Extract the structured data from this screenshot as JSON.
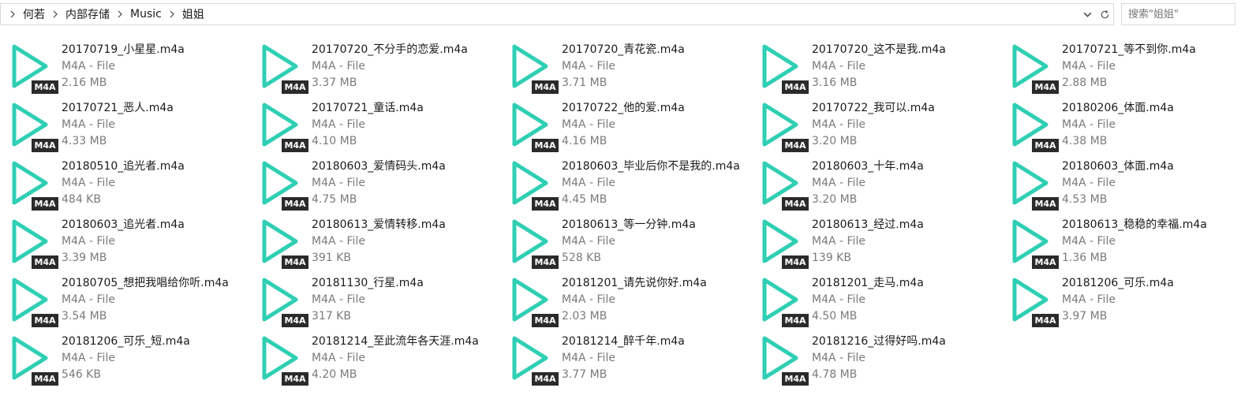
{
  "breadcrumb": {
    "items": [
      "何若",
      "内部存储",
      "Music",
      "姐姐"
    ]
  },
  "search": {
    "placeholder": "搜索\"姐姐\""
  },
  "icons": {
    "play": "play-icon",
    "chevron": "chevron-right-icon",
    "dropdown": "chevron-down-icon",
    "refresh": "refresh-icon"
  },
  "colors": {
    "accent": "#2fcfb4",
    "badge_bg": "#2b2b2b"
  },
  "files": [
    {
      "name": "20170719_小星星.m4a",
      "type": "M4A - File",
      "size": "2.16 MB",
      "badge": "M4A"
    },
    {
      "name": "20170720_不分手的恋爱.m4a",
      "type": "M4A - File",
      "size": "3.37 MB",
      "badge": "M4A"
    },
    {
      "name": "20170720_青花瓷.m4a",
      "type": "M4A - File",
      "size": "3.71 MB",
      "badge": "M4A"
    },
    {
      "name": "20170720_这不是我.m4a",
      "type": "M4A - File",
      "size": "3.16 MB",
      "badge": "M4A"
    },
    {
      "name": "20170721_等不到你.m4a",
      "type": "M4A - File",
      "size": "2.88 MB",
      "badge": "M4A"
    },
    {
      "name": "20170721_恶人.m4a",
      "type": "M4A - File",
      "size": "4.33 MB",
      "badge": "M4A"
    },
    {
      "name": "20170721_童话.m4a",
      "type": "M4A - File",
      "size": "4.10 MB",
      "badge": "M4A"
    },
    {
      "name": "20170722_他的爱.m4a",
      "type": "M4A - File",
      "size": "4.16 MB",
      "badge": "M4A"
    },
    {
      "name": "20170722_我可以.m4a",
      "type": "M4A - File",
      "size": "3.20 MB",
      "badge": "M4A"
    },
    {
      "name": "20180206_体面.m4a",
      "type": "M4A - File",
      "size": "4.38 MB",
      "badge": "M4A"
    },
    {
      "name": "20180510_追光者.m4a",
      "type": "M4A - File",
      "size": "484 KB",
      "badge": "M4A"
    },
    {
      "name": "20180603_爱情码头.m4a",
      "type": "M4A - File",
      "size": "4.75 MB",
      "badge": "M4A"
    },
    {
      "name": "20180603_毕业后你不是我的.m4a",
      "type": "M4A - File",
      "size": "4.45 MB",
      "badge": "M4A"
    },
    {
      "name": "20180603_十年.m4a",
      "type": "M4A - File",
      "size": "3.20 MB",
      "badge": "M4A"
    },
    {
      "name": "20180603_体面.m4a",
      "type": "M4A - File",
      "size": "4.53 MB",
      "badge": "M4A"
    },
    {
      "name": "20180603_追光者.m4a",
      "type": "M4A - File",
      "size": "3.39 MB",
      "badge": "M4A"
    },
    {
      "name": "20180613_爱情转移.m4a",
      "type": "M4A - File",
      "size": "391 KB",
      "badge": "M4A"
    },
    {
      "name": "20180613_等一分钟.m4a",
      "type": "M4A - File",
      "size": "528 KB",
      "badge": "M4A"
    },
    {
      "name": "20180613_经过.m4a",
      "type": "M4A - File",
      "size": "139 KB",
      "badge": "M4A"
    },
    {
      "name": "20180613_稳稳的幸福.m4a",
      "type": "M4A - File",
      "size": "1.36 MB",
      "badge": "M4A"
    },
    {
      "name": "20180705_想把我唱给你听.m4a",
      "type": "M4A - File",
      "size": "3.54 MB",
      "badge": "M4A"
    },
    {
      "name": "20181130_行星.m4a",
      "type": "M4A - File",
      "size": "317 KB",
      "badge": "M4A"
    },
    {
      "name": "20181201_请先说你好.m4a",
      "type": "M4A - File",
      "size": "2.03 MB",
      "badge": "M4A"
    },
    {
      "name": "20181201_走马.m4a",
      "type": "M4A - File",
      "size": "4.50 MB",
      "badge": "M4A"
    },
    {
      "name": "20181206_可乐.m4a",
      "type": "M4A - File",
      "size": "3.97 MB",
      "badge": "M4A"
    },
    {
      "name": "20181206_可乐_短.m4a",
      "type": "M4A - File",
      "size": "546 KB",
      "badge": "M4A"
    },
    {
      "name": "20181214_至此流年各天涯.m4a",
      "type": "M4A - File",
      "size": "4.20 MB",
      "badge": "M4A"
    },
    {
      "name": "20181214_醉千年.m4a",
      "type": "M4A - File",
      "size": "3.77 MB",
      "badge": "M4A"
    },
    {
      "name": "20181216_过得好吗.m4a",
      "type": "M4A - File",
      "size": "4.78 MB",
      "badge": "M4A"
    }
  ]
}
